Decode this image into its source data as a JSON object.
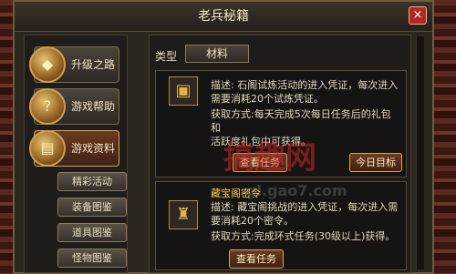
{
  "window": {
    "title": "老兵秘籍",
    "close_glyph": "×"
  },
  "nav": {
    "items": [
      {
        "label": "升级之路",
        "icon": "gem-icon",
        "glyph": "◆"
      },
      {
        "label": "游戏帮助",
        "icon": "scroll-icon",
        "glyph": "?"
      },
      {
        "label": "游戏资料",
        "icon": "book-icon",
        "glyph": "▤"
      }
    ],
    "sub_items": [
      "精彩活动",
      "装备图鉴",
      "道具图鉴",
      "怪物图鉴"
    ]
  },
  "content": {
    "type_label": "类型",
    "type_value": "材料",
    "cards": [
      {
        "desc_line1": "描述: 石阁试炼活动的进入凭证，每次进入",
        "desc_line2": "需要消耗20个试炼凭证。",
        "get_line1": "获取方式:每天完成5次每日任务后的礼包和",
        "get_line2": "活跃度礼包中可获得。",
        "button1": "查看任务",
        "button2": "今日目标"
      },
      {
        "name": "藏宝阁密令",
        "desc_line1": "描述: 藏宝阁挑战的进入凭证，每次进入需",
        "desc_line2": "要消耗20个密令。",
        "get_line1": "获取方式:完成环式任务(30级以上)获得。",
        "button1": "查看任务"
      }
    ]
  },
  "watermark": {
    "text": "搞趣网",
    "url": "gl.gao7.com"
  }
}
